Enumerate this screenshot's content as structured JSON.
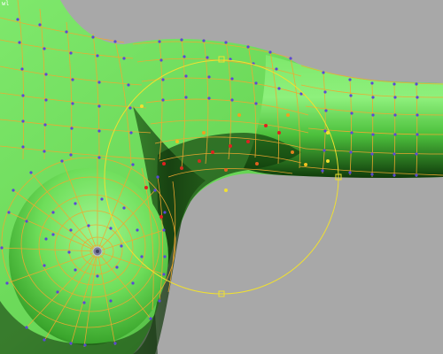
{
  "viewport": {
    "corner_label": "wl"
  },
  "colors": {
    "background": "#a8a8a8",
    "surface_light": "#8af07a",
    "surface_mid": "#5fd34e",
    "surface_dark": "#0f3a0a",
    "wire": "#f0a830",
    "gizmo": "#f0e030",
    "vertex": "#5a48d8",
    "selected_vertex": "#e02020"
  },
  "icons": {
    "soft_selection_gizmo": "circle-with-handles-icon",
    "vertex_markers": "dot-icon"
  }
}
